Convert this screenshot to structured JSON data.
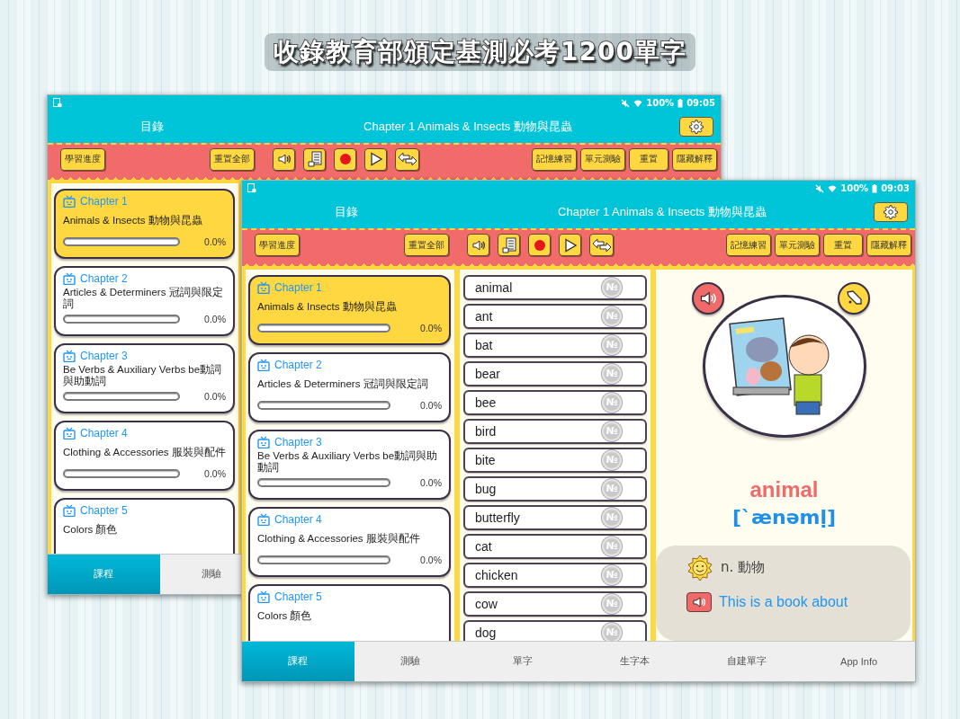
{
  "headline": "收錄教育部頒定基測必考1200單字",
  "screens": [
    {
      "status": {
        "battery": "100%",
        "time": "09:05"
      },
      "header": {
        "left": "目錄",
        "title": "Chapter 1  Animals & Insects 動物與昆蟲"
      },
      "toolbar": {
        "left": [
          "學習進度",
          "重置全部"
        ],
        "right": [
          "記憶練習",
          "單元測驗",
          "重置",
          "隱藏解釋"
        ]
      },
      "chapters": [
        {
          "label": "Chapter 1",
          "title": "Animals & Insects 動物與昆蟲",
          "level": 0,
          "percent": "0.0%",
          "selected": true
        },
        {
          "label": "Chapter 2",
          "title": "Articles & Determiners 冠詞與限定詞",
          "level": 0,
          "percent": "0.0%",
          "selected": false
        },
        {
          "label": "Chapter 3",
          "title": "Be Verbs & Auxiliary Verbs be動詞與助動詞",
          "level": 0,
          "percent": "0.0%",
          "selected": false
        },
        {
          "label": "Chapter 4",
          "title": "Clothing & Accessories 服裝與配件",
          "level": 0,
          "percent": "0.0%",
          "selected": false
        },
        {
          "label": "Chapter 5",
          "title": "Colors 顏色",
          "selected": false
        }
      ],
      "tabs": [
        {
          "label": "課程",
          "selected": true
        },
        {
          "label": "測驗",
          "selected": false
        }
      ]
    },
    {
      "status": {
        "battery": "100%",
        "time": "09:03"
      },
      "header": {
        "left": "目錄",
        "title": "Chapter 1  Animals & Insects 動物與昆蟲"
      },
      "toolbar": {
        "left": [
          "學習進度",
          "重置全部"
        ],
        "right": [
          "記憶練習",
          "單元測驗",
          "重置",
          "隱藏解釋"
        ]
      },
      "chapters": [
        {
          "label": "Chapter 1",
          "title": "Animals & Insects 動物與昆蟲",
          "level": 0,
          "percent": "0.0%",
          "selected": true
        },
        {
          "label": "Chapter 2",
          "title": "Articles & Determiners 冠詞與限定詞",
          "level": 0,
          "percent": "0.0%",
          "selected": false
        },
        {
          "label": "Chapter 3",
          "title": "Be Verbs & Auxiliary Verbs be動詞與助動詞",
          "level": 0,
          "percent": "0.0%",
          "selected": false
        },
        {
          "label": "Chapter 4",
          "title": "Clothing & Accessories 服裝與配件",
          "level": 0,
          "percent": "0.0%",
          "selected": false
        },
        {
          "label": "Chapter 5",
          "title": "Colors 顏色",
          "selected": false
        }
      ],
      "words": [
        {
          "word": "animal",
          "badge": "№"
        },
        {
          "word": "ant",
          "badge": "№"
        },
        {
          "word": "bat",
          "badge": "№"
        },
        {
          "word": "bear",
          "badge": "№"
        },
        {
          "word": "bee",
          "badge": "№"
        },
        {
          "word": "bird",
          "badge": "№"
        },
        {
          "word": "bite",
          "badge": "№"
        },
        {
          "word": "bug",
          "badge": "№"
        },
        {
          "word": "butterfly",
          "badge": "№"
        },
        {
          "word": "cat",
          "badge": "№"
        },
        {
          "word": "chicken",
          "badge": "№"
        },
        {
          "word": "cow",
          "badge": "№"
        },
        {
          "word": "dog",
          "badge": "№"
        }
      ],
      "detail": {
        "word": "animal",
        "phonetic": "[`ænəmḷ]",
        "definition": "n.  動物",
        "example": "This is a book about"
      },
      "tabs": [
        {
          "label": "課程",
          "selected": true
        },
        {
          "label": "測驗",
          "selected": false
        },
        {
          "label": "單字",
          "selected": false
        },
        {
          "label": "生字本",
          "selected": false
        },
        {
          "label": "自建單字",
          "selected": false
        },
        {
          "label": "App Info",
          "selected": false
        }
      ]
    }
  ]
}
